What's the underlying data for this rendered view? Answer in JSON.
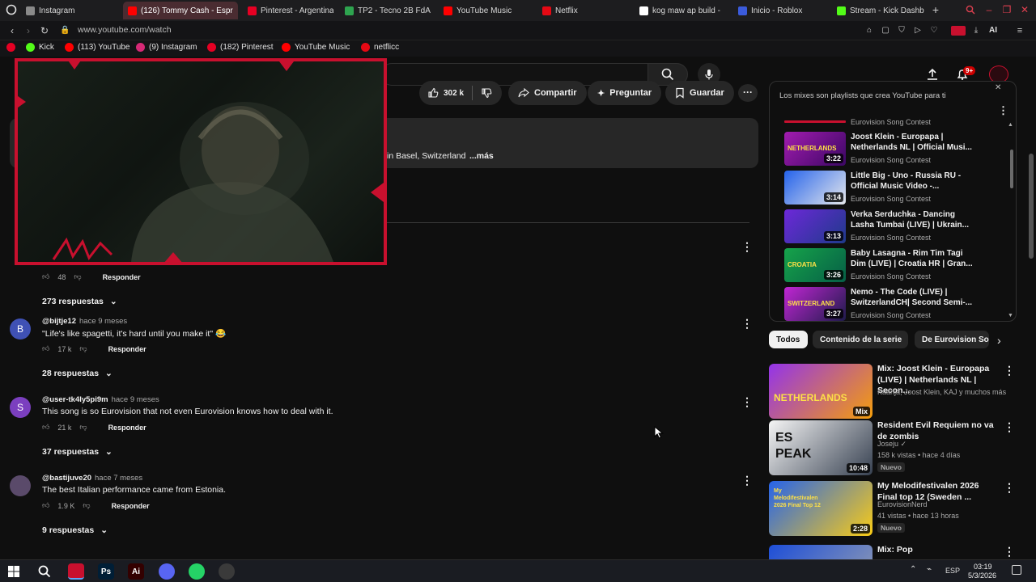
{
  "browser": {
    "tabs": [
      {
        "label": "Instagram",
        "fav": "#8a8a8a"
      },
      {
        "label": "(126) Tommy Cash - Espr",
        "fav": "#ff0000",
        "active": true
      },
      {
        "label": "Pinterest - Argentina",
        "fav": "#e60023"
      },
      {
        "label": "TP2 - Tecno 2B FdA",
        "fav": "#2ea44f"
      },
      {
        "label": "YouTube Music",
        "fav": "#ff0000"
      },
      {
        "label": "Netflix",
        "fav": "#e50914"
      },
      {
        "label": "kog maw ap build - ",
        "fav": "#ffffff"
      },
      {
        "label": "Inicio - Roblox",
        "fav": "#3b5bdb"
      },
      {
        "label": "Stream - Kick Dashb",
        "fav": "#53fc18"
      }
    ],
    "new_tab": "+",
    "url": "www.youtube.com/watch",
    "ai_label": "AI",
    "bookmarks": [
      {
        "label": "Kick",
        "fav": "#53fc18"
      },
      {
        "label": "(113) YouTube",
        "fav": "#ff0000"
      },
      {
        "label": "(9) Instagram",
        "fav": "#d62976"
      },
      {
        "label": "(182) Pinterest",
        "fav": "#e60023"
      },
      {
        "label": "YouTube Music",
        "fav": "#ff0000"
      },
      {
        "label": "netflicc",
        "fav": "#e50914"
      }
    ]
  },
  "youtube": {
    "notif_count": "9+",
    "actions": {
      "likes": "302 k",
      "share": "Compartir",
      "ask": "Preguntar",
      "save": "Guardar"
    },
    "description_snippet": "in Basel, Switzerland",
    "description_more": "...más",
    "comments": [
      {
        "handle": "",
        "ago": "",
        "text": "",
        "likes": "48",
        "reply": "Responder",
        "replies": "273 respuestas"
      },
      {
        "handle": "@bijtje12",
        "ago": "hace 9 meses",
        "text": "\"Life's like spagetti, it's hard until you make it\" 😂",
        "likes": "17 k",
        "reply": "Responder",
        "replies": "28 respuestas",
        "avatar_letter": "B",
        "avatar_color": "#3f51b5"
      },
      {
        "handle": "@user-tk4ly5pi9m",
        "ago": "hace 9 meses",
        "text": "This song is so Eurovision that not even Eurovision knows how to deal with it.",
        "likes": "21 k",
        "reply": "Responder",
        "replies": "37 respuestas",
        "avatar_letter": "S",
        "avatar_color": "#7b3fbf"
      },
      {
        "handle": "@bastijuve20",
        "ago": "hace 7 meses",
        "text": "The best Italian performance came from Estonia.",
        "likes": "1.9 K",
        "reply": "Responder",
        "replies": "9 respuestas",
        "avatar_letter": "",
        "avatar_color": "#5a4a6a"
      }
    ],
    "playlist": {
      "header_note": "Los mixes son playlists que crea YouTube para ti",
      "top_channel": "Eurovision Song Contest",
      "items": [
        {
          "title": "Joost Klein - Europapa | Netherlands NL | Official Musi...",
          "channel": "Eurovision Song Contest",
          "duration": "3:22",
          "thumb": "NETHERLANDS",
          "c1": "#a21caf",
          "c2": "#3b0764"
        },
        {
          "title": "Little Big - Uno - Russia RU - Official Music Video -...",
          "channel": "Eurovision Song Contest",
          "duration": "3:14",
          "thumb": "",
          "c1": "#2563eb",
          "c2": "#e5e7eb"
        },
        {
          "title": "Verka Serduchka - Dancing Lasha Tumbai (LIVE) | Ukrain...",
          "channel": "Eurovision Song Contest",
          "duration": "3:13",
          "thumb": "",
          "c1": "#6d28d9",
          "c2": "#1e3a8a"
        },
        {
          "title": "Baby Lasagna - Rim Tim Tagi Dim (LIVE) | Croatia HR | Gran...",
          "channel": "Eurovision Song Contest",
          "duration": "3:26",
          "thumb": "CROATIA",
          "c1": "#16a34a",
          "c2": "#065f46"
        },
        {
          "title": "Nemo - The Code (LIVE) | SwitzerlandCH| Second Semi-...",
          "channel": "Eurovision Song Contest",
          "duration": "3:27",
          "thumb": "SWITZERLAND",
          "c1": "#c026d3",
          "c2": "#1e1b4b"
        }
      ]
    },
    "chips": [
      "Todos",
      "Contenido de la serie",
      "De Eurovision So"
    ],
    "recommendations": [
      {
        "title": "Mix: Joost Klein - Europapa (LIVE) | Netherlands NL | Secon...",
        "meta1": "Käärijä, Joost Klein, KAJ y muchos más",
        "meta2": "",
        "badge": "",
        "duration": "Mix",
        "thumb_text": "NETHERLANDS",
        "c1": "#9333ea",
        "c2": "#f59e0b"
      },
      {
        "title": "Resident Evil Requiem no va de zombis",
        "meta1": "Joseju ✓",
        "meta2": "158 k vistas • hace 4 días",
        "badge": "Nuevo",
        "duration": "10:48",
        "thumb_text": "ES PEAK",
        "c1": "#f5f5f5",
        "c2": "#374151"
      },
      {
        "title": "My Melodifestivalen 2026 Final top 12 (Sweden ...",
        "meta1": "EurovisionNerd",
        "meta2": "41 vistas • hace 13 horas",
        "badge": "Nuevo",
        "duration": "2:28",
        "thumb_text": "My Melodifestivalen 2026 Final Top 12",
        "c1": "#2563eb",
        "c2": "#facc15"
      },
      {
        "title": "Mix: Pop",
        "meta1": "",
        "meta2": "",
        "badge": "",
        "duration": "",
        "thumb_text": "",
        "c1": "#1d4ed8",
        "c2": "#9ca3af"
      }
    ]
  },
  "taskbar": {
    "lang": "ESP",
    "time": "03:19",
    "date": "5/3/2026",
    "apps": [
      {
        "label": "",
        "color": "#c8102e"
      },
      {
        "label": "Ps",
        "color": "#001e36"
      },
      {
        "label": "Ai",
        "color": "#330000"
      },
      {
        "label": "",
        "color": "#5865f2"
      },
      {
        "label": "",
        "color": "#25d366"
      },
      {
        "label": "",
        "color": "#3a3a3a"
      }
    ]
  },
  "colors": {
    "accent": "#ff0000",
    "overlay_border": "#c8102e"
  }
}
